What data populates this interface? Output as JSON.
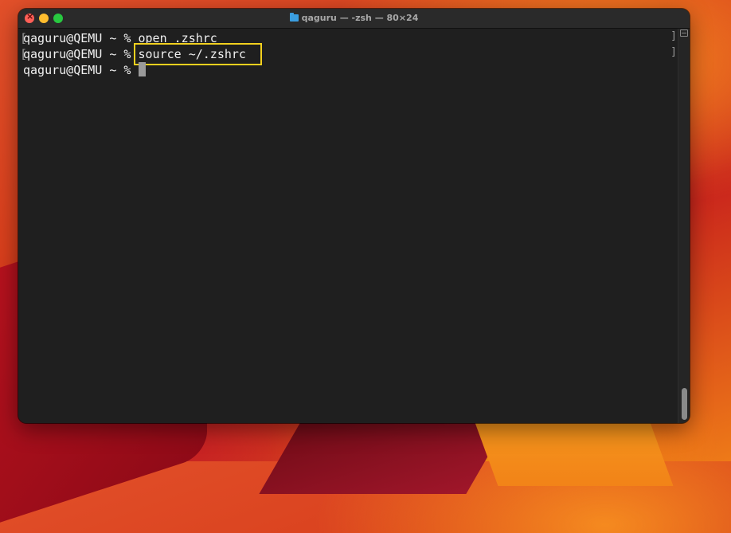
{
  "window": {
    "title": "qaguru — -zsh — 80×24"
  },
  "terminal": {
    "lines": [
      {
        "prompt": "qaguru@QEMU ~ % ",
        "command": "open .zshrc"
      },
      {
        "prompt": "qaguru@QEMU ~ % ",
        "command": "source ~/.zshrc"
      },
      {
        "prompt": "qaguru@QEMU ~ % ",
        "command": ""
      }
    ],
    "highlight_color": "#f2d01e"
  },
  "icons": {
    "title": "folder-icon",
    "close": "close-icon",
    "minimize": "minimize-icon",
    "maximize": "maximize-icon"
  }
}
